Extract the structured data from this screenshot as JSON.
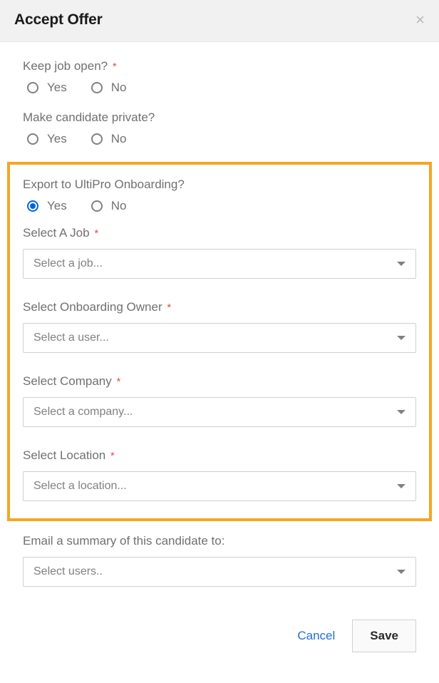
{
  "header": {
    "title": "Accept Offer"
  },
  "fields": {
    "keep_job": {
      "label": "Keep job open?",
      "yes": "Yes",
      "no": "No"
    },
    "make_private": {
      "label": "Make candidate private?",
      "yes": "Yes",
      "no": "No"
    },
    "export": {
      "label": "Export to UltiPro Onboarding?",
      "yes": "Yes",
      "no": "No"
    },
    "select_job": {
      "label": "Select A Job",
      "placeholder": "Select a job..."
    },
    "select_owner": {
      "label": "Select Onboarding Owner",
      "placeholder": "Select a user..."
    },
    "select_company": {
      "label": "Select Company",
      "placeholder": "Select a company..."
    },
    "select_location": {
      "label": "Select Location",
      "placeholder": "Select a location..."
    },
    "email_summary": {
      "label": "Email a summary of this candidate to:",
      "placeholder": "Select users.."
    }
  },
  "footer": {
    "cancel": "Cancel",
    "save": "Save"
  },
  "required_mark": "*"
}
